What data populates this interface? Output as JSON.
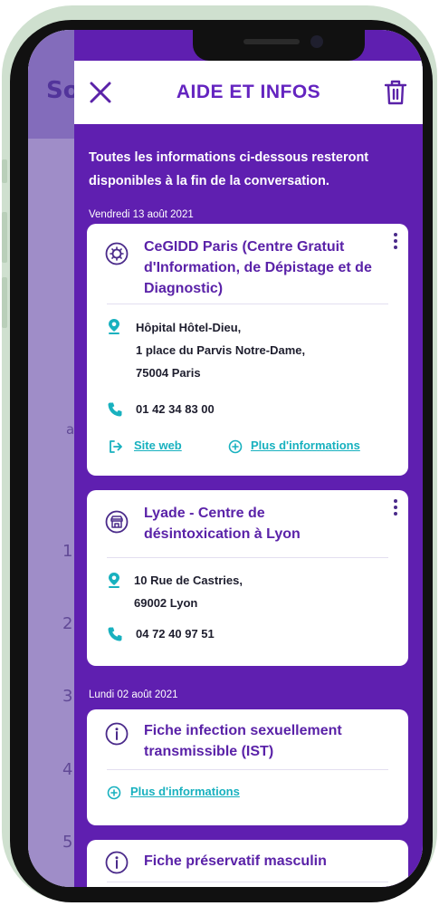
{
  "background_app": {
    "title_fragment": "So",
    "fragments": [
      "a",
      "1",
      "2",
      "3",
      "4",
      "5"
    ]
  },
  "sheet": {
    "title": "AIDE ET INFOS",
    "intro": "Toutes les informations ci-dessous resteront disponibles à la fin de la conversation.",
    "groups": [
      {
        "date": "Vendredi 13 août 2021",
        "cards": [
          {
            "icon": "virus-icon",
            "title": "CeGIDD Paris (Centre Gratuit d'Information, de Dépistage et de Diagnostic)",
            "address_lines": [
              "Hôpital Hôtel-Dieu,",
              "1 place du Parvis Notre-Dame,",
              "75004 Paris"
            ],
            "phone": "01 42 34 83 00",
            "website_label": "Site web",
            "more_label": "Plus d'informations"
          },
          {
            "icon": "store-icon",
            "title": "Lyade - Centre de désintoxication à Lyon",
            "address_lines": [
              "10 Rue de Castries,",
              "69002 Lyon"
            ],
            "phone": "04 72 40 97 51"
          }
        ]
      },
      {
        "date": "Lundi 02 août 2021",
        "cards": [
          {
            "icon": "info-icon",
            "title": "Fiche infection sexuellement transmissible (IST)",
            "more_label": "Plus d'informations"
          },
          {
            "icon": "info-icon",
            "title": "Fiche préservatif masculin"
          }
        ]
      }
    ]
  },
  "colors": {
    "sheet_bg": "#5f1fb0",
    "accent": "#6424c0",
    "link": "#18b1bf",
    "phone_frame": "#cfe0cf"
  }
}
